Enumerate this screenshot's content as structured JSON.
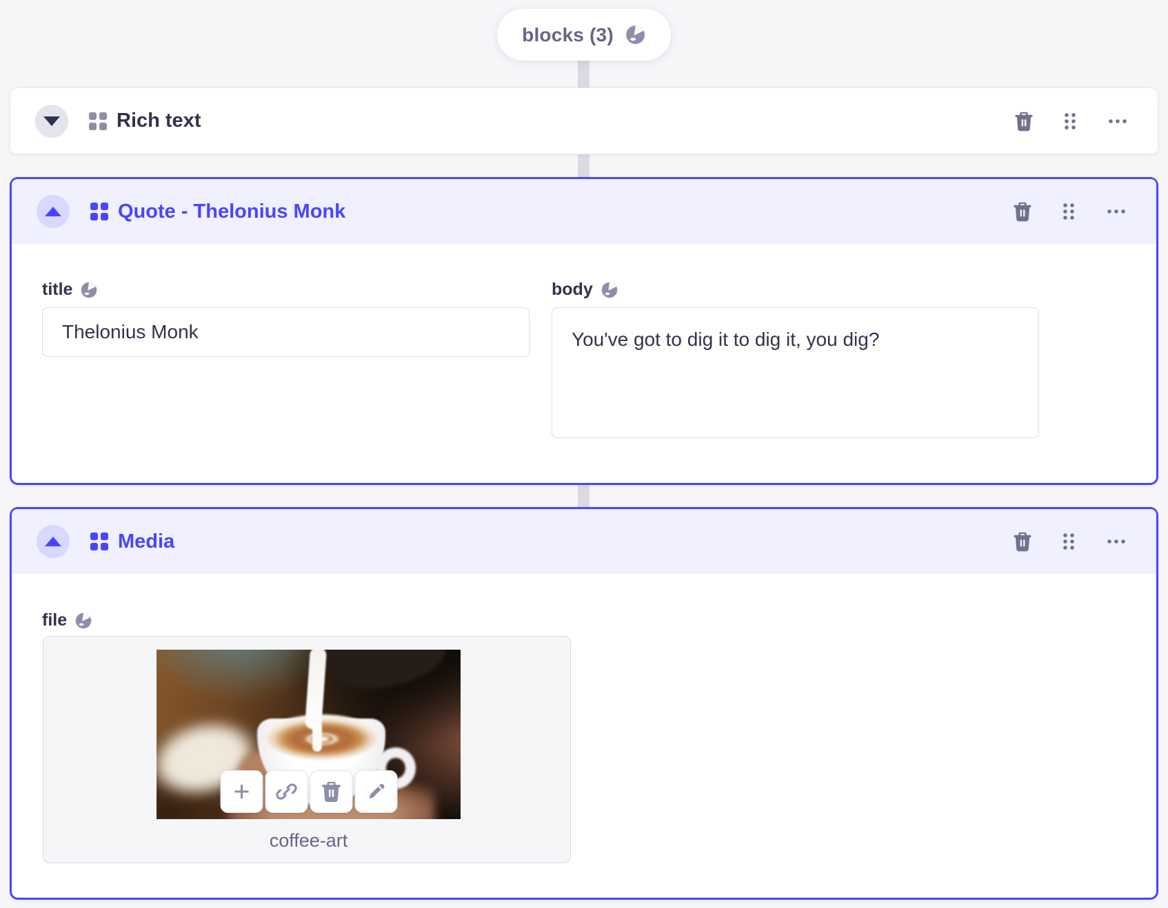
{
  "pill": {
    "label": "blocks (3)"
  },
  "blocks": [
    {
      "label": "Rich text",
      "state": "collapsed"
    },
    {
      "label": "Quote - Thelonius Monk",
      "state": "expanded",
      "fields": {
        "title": {
          "label": "title",
          "value": "Thelonius Monk",
          "localized": true
        },
        "body": {
          "label": "body",
          "value": "You've got to dig it to dig it, you dig?",
          "localized": true
        }
      }
    },
    {
      "label": "Media",
      "state": "expanded",
      "fields": {
        "file": {
          "label": "file",
          "filename": "coffee-art",
          "localized": true
        }
      }
    }
  ],
  "header_actions": {
    "delete": "delete",
    "drag": "drag",
    "more": "more options"
  },
  "media_actions": {
    "add": "add",
    "link": "copy link",
    "delete": "delete",
    "edit": "edit"
  },
  "colors": {
    "primary": "#4945ff",
    "primary_light_bg": "#f0f0ff",
    "page_bg": "#f6f6f9",
    "text_dark": "#32324d",
    "text_muted": "#666687",
    "icon_gray": "#8e8ea9",
    "border": "#dcdce4"
  }
}
